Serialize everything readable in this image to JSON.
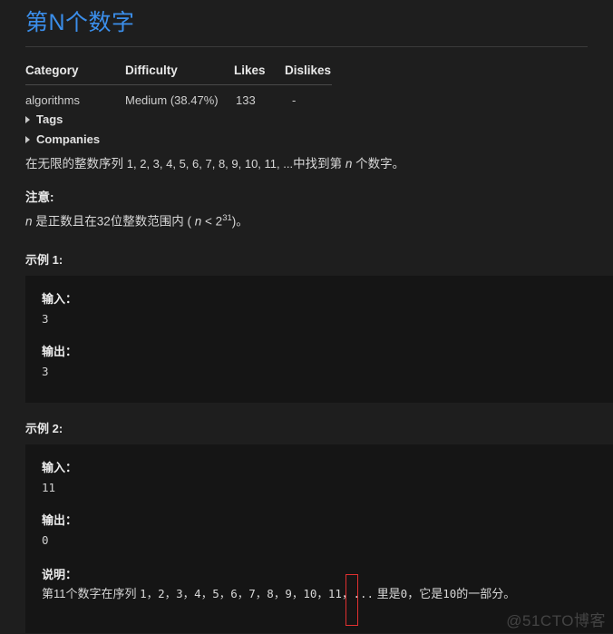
{
  "page": {
    "title": "第N个数字",
    "title_color": "#3b8eea",
    "background": "#1e1e1e",
    "code_background": "#151515"
  },
  "meta_table": {
    "headers": [
      "Category",
      "Difficulty",
      "Likes",
      "Dislikes"
    ],
    "row": {
      "category": "algorithms",
      "difficulty": "Medium (38.47%)",
      "likes": "133",
      "dislikes": "-"
    }
  },
  "collapsibles": [
    {
      "label": "Tags",
      "icon": "triangle-right-icon",
      "expanded": false
    },
    {
      "label": "Companies",
      "icon": "triangle-right-icon",
      "expanded": false
    }
  ],
  "description": {
    "prefix": "在无限的整数序列 ",
    "sequence": "1, 2, 3, 4, 5, 6, 7, 8, 9, 10, 11, ...",
    "middle": "中找到第 ",
    "variable": "n",
    "suffix": " 个数字。"
  },
  "note": {
    "heading": "注意:",
    "var1": "n",
    "text1": " 是正数且在32位整数范围内 ( ",
    "var2": "n",
    "operator": " < 2",
    "exponent": "31",
    "text2": ")。"
  },
  "examples": [
    {
      "label": "示例 1:",
      "input_label": "输入：",
      "input_value": "3",
      "output_label": "输出：",
      "output_value": "3"
    },
    {
      "label": "示例 2:",
      "input_label": "输入：",
      "input_value": "11",
      "output_label": "输出：",
      "output_value": "0",
      "explanation_label": "说明：",
      "explanation_prefix": "第11个数字在序列 ",
      "explanation_sequence": "1，2，3，4，5，6，7，8，9，10，11，...",
      "explanation_middle": " 里是",
      "explanation_zero": "0",
      "explanation_middle2": "，它是",
      "explanation_ten": "10",
      "explanation_suffix": "的一部分。"
    }
  ],
  "annotation": {
    "type": "red-rectangle",
    "color": "#e03030",
    "highlights": "10"
  },
  "watermark": {
    "text": "@51CTO博客"
  }
}
